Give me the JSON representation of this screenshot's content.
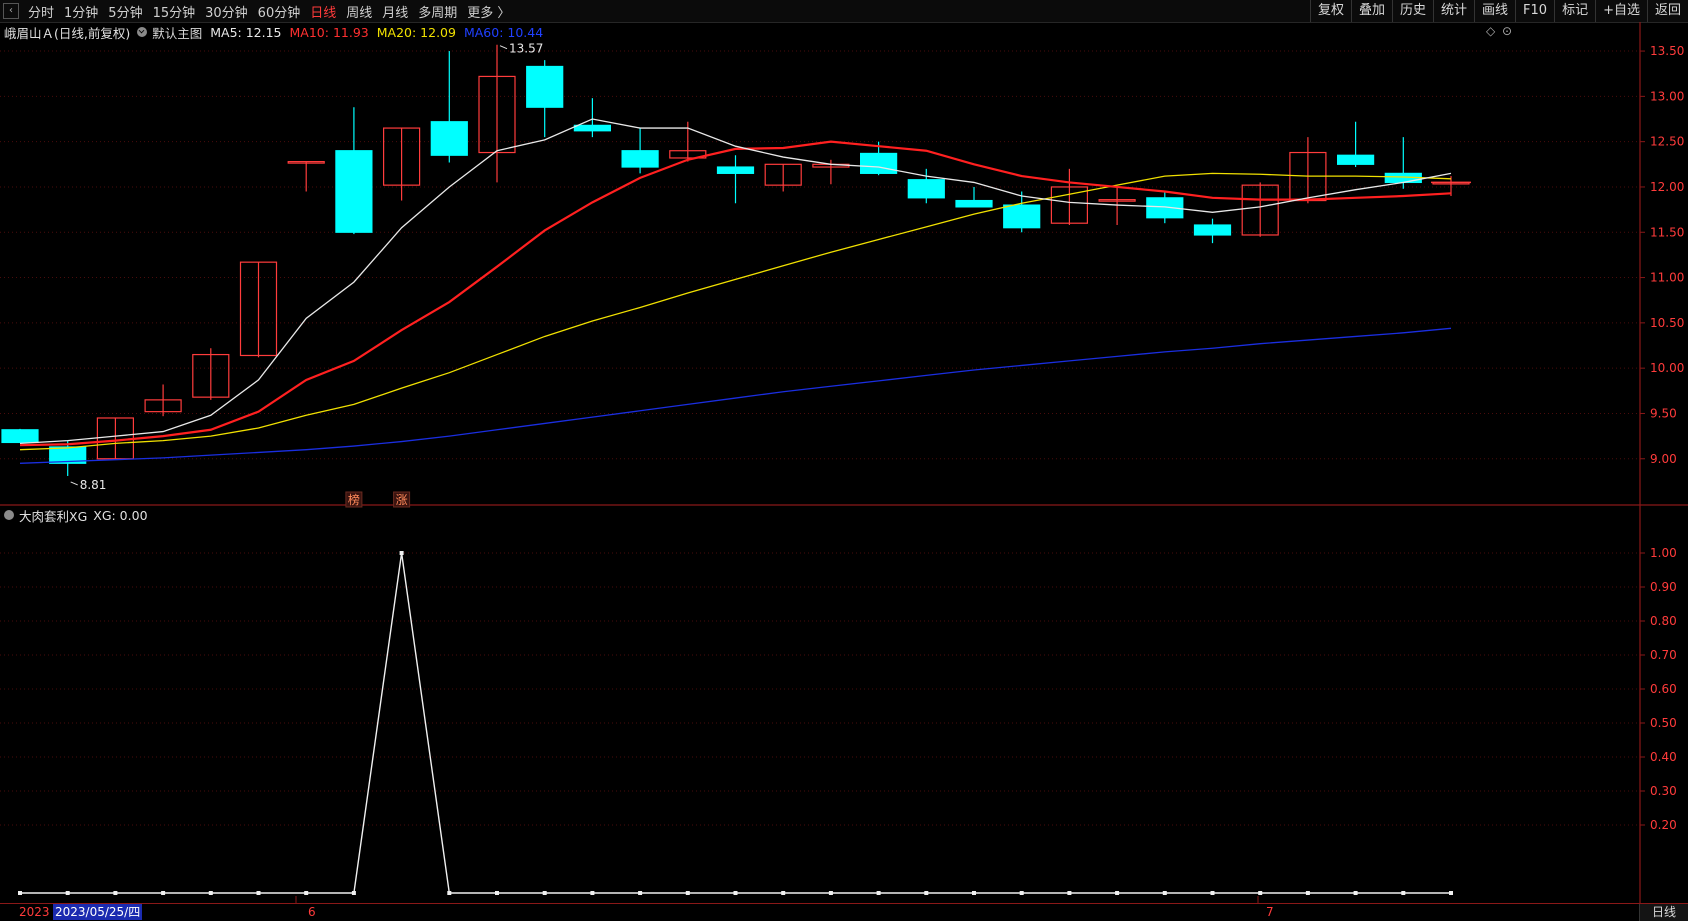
{
  "toolbar": {
    "back": "‹",
    "tabs": [
      "分时",
      "1分钟",
      "5分钟",
      "15分钟",
      "30分钟",
      "60分钟",
      "日线",
      "周线",
      "月线",
      "多周期",
      "更多 〉"
    ],
    "active_tab": "日线",
    "right_buttons": [
      "复权",
      "叠加",
      "历史",
      "统计",
      "画线",
      "F10",
      "标记",
      "+自选",
      "返回"
    ]
  },
  "info": {
    "stock": "峨眉山Ａ(日线,前复权)",
    "main_label": "默认主图",
    "ma": [
      {
        "text": "MA5: 12.15",
        "color": "#e8e8e8"
      },
      {
        "text": "MA10: 11.93",
        "color": "#ff3030"
      },
      {
        "text": "MA20: 12.09",
        "color": "#f0e000"
      },
      {
        "text": "MA60: 10.44",
        "color": "#2040ff"
      }
    ],
    "right_icons": [
      "◇",
      "⊙"
    ]
  },
  "sub": {
    "label": "大肉套利XG",
    "value": "XG: 0.00"
  },
  "bottom": {
    "date_start": "2023",
    "date_cursor": "2023/05/25/四",
    "month_ticks": [
      "6",
      "7"
    ],
    "period": "日线"
  },
  "colors": {
    "up": "#ff3c3c",
    "down": "#00ffff",
    "ma5": "#e8e8e8",
    "ma10": "#ff2020",
    "ma20": "#f0e000",
    "ma60": "#1a2ee0",
    "grid": "#8a1818",
    "axis_text": "#ff3b3b"
  },
  "chart_data": [
    {
      "type": "candlestick",
      "title": "峨眉山Ａ(日线,前复权)",
      "y_axis_ticks": [
        "13.50",
        "13.00",
        "12.50",
        "12.00",
        "11.50",
        "11.00",
        "10.50",
        "10.00",
        "9.50",
        "9.00"
      ],
      "ylim": [
        8.6,
        13.6
      ],
      "candles": [
        {
          "o": 9.32,
          "h": 9.33,
          "l": 9.18,
          "c": 9.18
        },
        {
          "o": 9.13,
          "h": 9.2,
          "l": 8.81,
          "c": 8.95
        },
        {
          "o": 9.0,
          "h": 9.45,
          "l": 8.99,
          "c": 9.45
        },
        {
          "o": 9.52,
          "h": 9.82,
          "l": 9.47,
          "c": 9.65
        },
        {
          "o": 9.68,
          "h": 10.22,
          "l": 9.65,
          "c": 10.15
        },
        {
          "o": 10.14,
          "h": 11.17,
          "l": 10.12,
          "c": 11.17
        },
        {
          "o": 12.28,
          "h": 12.28,
          "l": 11.95,
          "c": 12.28
        },
        {
          "o": 12.4,
          "h": 12.88,
          "l": 11.48,
          "c": 11.5
        },
        {
          "o": 12.02,
          "h": 12.65,
          "l": 11.85,
          "c": 12.65
        },
        {
          "o": 12.72,
          "h": 13.5,
          "l": 12.27,
          "c": 12.35
        },
        {
          "o": 12.38,
          "h": 13.57,
          "l": 12.05,
          "c": 13.22
        },
        {
          "o": 13.33,
          "h": 13.4,
          "l": 12.55,
          "c": 12.88
        },
        {
          "o": 12.68,
          "h": 12.98,
          "l": 12.55,
          "c": 12.62
        },
        {
          "o": 12.4,
          "h": 12.65,
          "l": 12.15,
          "c": 12.22
        },
        {
          "o": 12.32,
          "h": 12.72,
          "l": 12.28,
          "c": 12.4
        },
        {
          "o": 12.22,
          "h": 12.35,
          "l": 11.82,
          "c": 12.15
        },
        {
          "o": 12.02,
          "h": 12.25,
          "l": 11.95,
          "c": 12.25
        },
        {
          "o": 12.22,
          "h": 12.3,
          "l": 12.03,
          "c": 12.25
        },
        {
          "o": 12.37,
          "h": 12.5,
          "l": 12.13,
          "c": 12.15
        },
        {
          "o": 12.08,
          "h": 12.2,
          "l": 11.82,
          "c": 11.88
        },
        {
          "o": 11.85,
          "h": 12.0,
          "l": 11.8,
          "c": 11.78
        },
        {
          "o": 11.8,
          "h": 11.95,
          "l": 11.5,
          "c": 11.55
        },
        {
          "o": 11.6,
          "h": 12.2,
          "l": 11.58,
          "c": 12.0
        },
        {
          "o": 11.86,
          "h": 12.0,
          "l": 11.58,
          "c": 11.86
        },
        {
          "o": 11.88,
          "h": 11.95,
          "l": 11.6,
          "c": 11.66
        },
        {
          "o": 11.58,
          "h": 11.65,
          "l": 11.38,
          "c": 11.47
        },
        {
          "o": 11.47,
          "h": 12.05,
          "l": 11.45,
          "c": 12.02
        },
        {
          "o": 11.85,
          "h": 12.55,
          "l": 11.82,
          "c": 12.38
        },
        {
          "o": 12.35,
          "h": 12.72,
          "l": 12.22,
          "c": 12.25
        },
        {
          "o": 12.15,
          "h": 12.55,
          "l": 11.98,
          "c": 12.05
        },
        {
          "o": 12.05,
          "h": 12.12,
          "l": 11.9,
          "c": 12.05
        }
      ],
      "ma5": [
        9.17,
        9.2,
        9.25,
        9.3,
        9.48,
        9.87,
        10.55,
        10.95,
        11.55,
        12.0,
        12.4,
        12.52,
        12.75,
        12.65,
        12.65,
        12.45,
        12.33,
        12.25,
        12.22,
        12.12,
        12.05,
        11.9,
        11.83,
        11.8,
        11.78,
        11.72,
        11.78,
        11.88,
        11.97,
        12.05,
        12.15
      ],
      "ma10": [
        9.15,
        9.16,
        9.2,
        9.25,
        9.32,
        9.52,
        9.87,
        10.08,
        10.42,
        10.73,
        11.12,
        11.52,
        11.83,
        12.1,
        12.3,
        12.42,
        12.43,
        12.5,
        12.45,
        12.4,
        12.25,
        12.12,
        12.05,
        12.0,
        11.95,
        11.88,
        11.86,
        11.86,
        11.88,
        11.9,
        11.93
      ],
      "ma20": [
        9.1,
        9.12,
        9.17,
        9.2,
        9.25,
        9.34,
        9.48,
        9.6,
        9.78,
        9.95,
        10.15,
        10.35,
        10.52,
        10.67,
        10.83,
        10.98,
        11.13,
        11.28,
        11.42,
        11.56,
        11.7,
        11.82,
        11.92,
        12.02,
        12.12,
        12.15,
        12.14,
        12.12,
        12.12,
        12.11,
        12.09
      ],
      "ma60": [
        8.95,
        8.97,
        8.99,
        9.01,
        9.04,
        9.07,
        9.1,
        9.14,
        9.19,
        9.25,
        9.32,
        9.39,
        9.46,
        9.53,
        9.6,
        9.67,
        9.74,
        9.8,
        9.86,
        9.92,
        9.98,
        10.03,
        10.08,
        10.13,
        10.18,
        10.22,
        10.27,
        10.31,
        10.35,
        10.39,
        10.44
      ],
      "annotations": [
        {
          "text": "13.57",
          "candle": 10,
          "value": 13.57
        },
        {
          "text": "8.81",
          "candle": 1,
          "value": 8.81
        }
      ],
      "markers": [
        {
          "text": "榜",
          "candle": 7
        },
        {
          "text": "涨",
          "candle": 8
        }
      ]
    },
    {
      "type": "line",
      "title": "大肉套利XG",
      "y_axis_ticks": [
        "1.00",
        "0.90",
        "0.80",
        "0.70",
        "0.60",
        "0.50",
        "0.40",
        "0.30",
        "0.20"
      ],
      "ylim": [
        0,
        1
      ],
      "series": [
        {
          "name": "XG",
          "values": [
            0,
            0,
            0,
            0,
            0,
            0,
            0,
            0,
            1,
            0,
            0,
            0,
            0,
            0,
            0,
            0,
            0,
            0,
            0,
            0,
            0,
            0,
            0,
            0,
            0,
            0,
            0,
            0,
            0,
            0,
            0
          ]
        }
      ]
    }
  ]
}
